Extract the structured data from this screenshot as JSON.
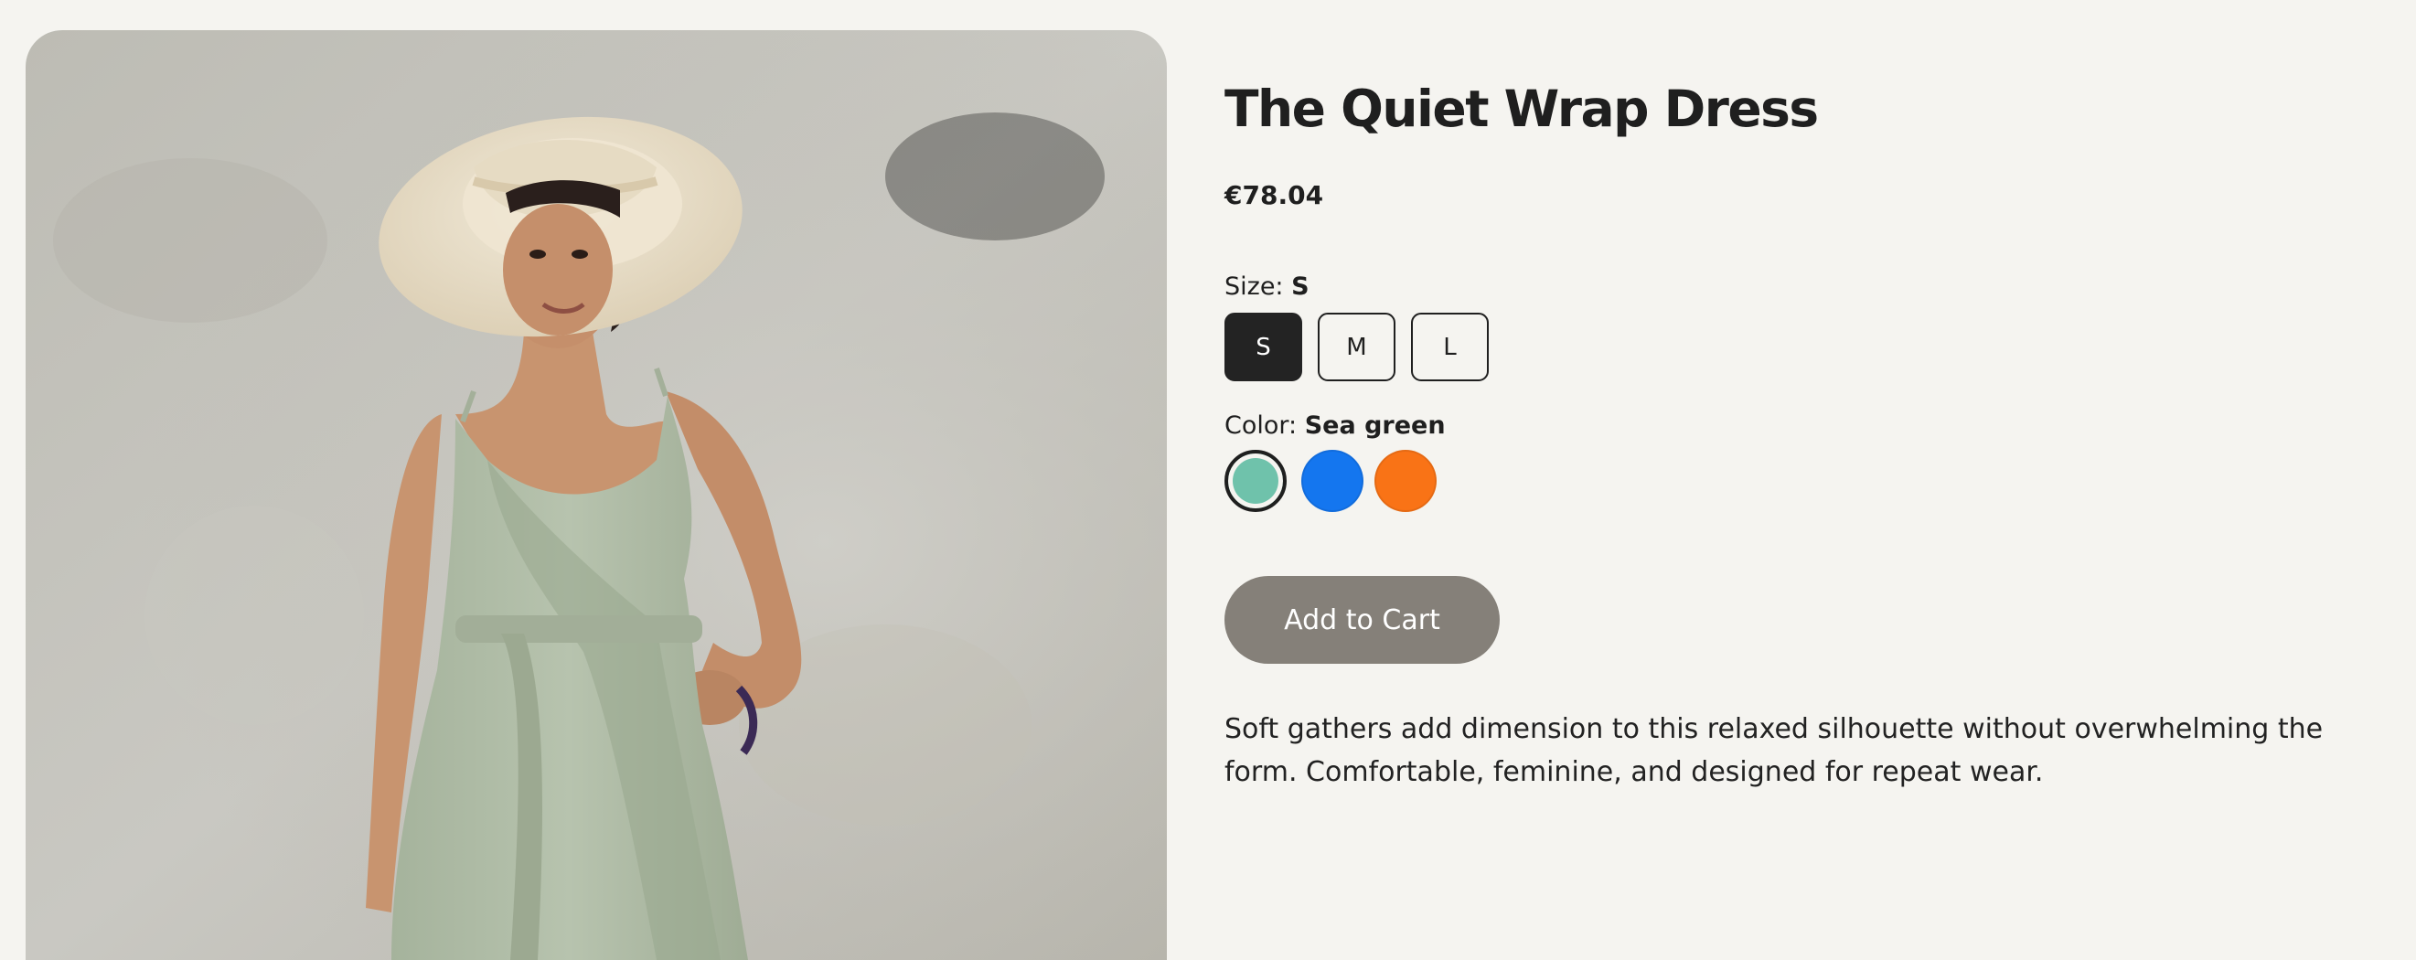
{
  "product": {
    "title": "The Quiet Wrap Dress",
    "price": "€78.04",
    "image_alt": "Woman in a sea green wrap dress and wide-brimmed straw hat",
    "description": "Soft gathers add dimension to this relaxed silhouette without overwhelming the form. Comfortable, feminine, and designed for repeat wear."
  },
  "size": {
    "label": "Size:",
    "selected": "S",
    "options": [
      "S",
      "M",
      "L"
    ]
  },
  "color": {
    "label": "Color:",
    "selected": "Sea green",
    "options": [
      {
        "name": "Sea green",
        "hex": "#6fc2ab"
      },
      {
        "name": "Blue",
        "hex": "#1476ef"
      },
      {
        "name": "Orange",
        "hex": "#f97316"
      }
    ]
  },
  "actions": {
    "add_to_cart": "Add to Cart"
  },
  "colors": {
    "background": "#f5f4f0",
    "text": "#1f1f1f",
    "selected_size_bg": "#232323",
    "cart_button_bg": "#858079"
  }
}
